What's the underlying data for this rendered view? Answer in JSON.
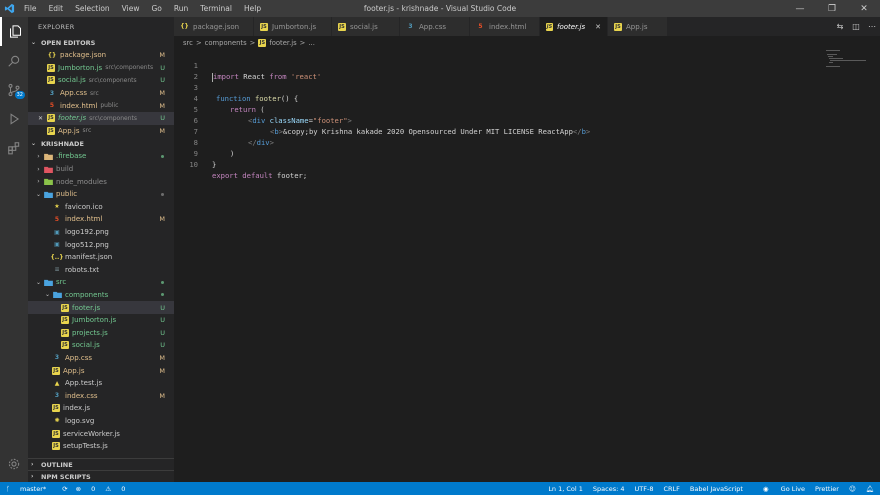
{
  "window": {
    "title": "footer.js - krishnade - Visual Studio Code",
    "menu": [
      "File",
      "Edit",
      "Selection",
      "View",
      "Go",
      "Run",
      "Terminal",
      "Help"
    ],
    "controls": [
      "—",
      "❐",
      "✕"
    ]
  },
  "activity": {
    "scm_badge": "32"
  },
  "sidebar": {
    "title": "EXPLORER",
    "open_editors_label": "OPEN EDITORS",
    "open_editors": [
      {
        "name": "package.json",
        "desc": "",
        "status": "M",
        "icon": "json-icon"
      },
      {
        "name": "Jumborton.js",
        "desc": "src\\components",
        "status": "U",
        "icon": "js-icon"
      },
      {
        "name": "social.js",
        "desc": "src\\components",
        "status": "U",
        "icon": "js-icon"
      },
      {
        "name": "App.css",
        "desc": "src",
        "status": "M",
        "icon": "css-icon"
      },
      {
        "name": "index.html",
        "desc": "public",
        "status": "M",
        "icon": "html-icon"
      },
      {
        "name": "footer.js",
        "desc": "src\\components",
        "status": "U",
        "icon": "js-icon"
      },
      {
        "name": "App.js",
        "desc": "src",
        "status": "M",
        "icon": "js-icon"
      }
    ],
    "project_label": "KRISHNADE",
    "tree": [
      {
        "name": ".firebase",
        "indent": 0,
        "type": "folder",
        "chev": "›"
      },
      {
        "name": "build",
        "indent": 0,
        "type": "folder",
        "chev": "›"
      },
      {
        "name": "node_modules",
        "indent": 0,
        "type": "folder",
        "chev": "›"
      },
      {
        "name": "public",
        "indent": 0,
        "type": "folder",
        "chev": "⌄"
      },
      {
        "name": "favicon.ico",
        "indent": 1,
        "type": "file",
        "icon": "star-icon"
      },
      {
        "name": "index.html",
        "indent": 1,
        "type": "file",
        "icon": "html-icon",
        "status": "M"
      },
      {
        "name": "logo192.png",
        "indent": 1,
        "type": "file",
        "icon": "image-icon"
      },
      {
        "name": "logo512.png",
        "indent": 1,
        "type": "file",
        "icon": "image-icon"
      },
      {
        "name": "manifest.json",
        "indent": 1,
        "type": "file",
        "icon": "braces-icon"
      },
      {
        "name": "robots.txt",
        "indent": 1,
        "type": "file",
        "icon": "text-icon"
      },
      {
        "name": "src",
        "indent": 0,
        "type": "folder",
        "chev": "⌄"
      },
      {
        "name": "components",
        "indent": 1,
        "type": "folder",
        "chev": "⌄"
      },
      {
        "name": "footer.js",
        "indent": 2,
        "type": "file",
        "icon": "js-icon",
        "status": "U"
      },
      {
        "name": "Jumborton.js",
        "indent": 2,
        "type": "file",
        "icon": "js-icon",
        "status": "U"
      },
      {
        "name": "projects.js",
        "indent": 2,
        "type": "file",
        "icon": "js-icon",
        "status": "U"
      },
      {
        "name": "social.js",
        "indent": 2,
        "type": "file",
        "icon": "js-icon",
        "status": "U"
      },
      {
        "name": "App.css",
        "indent": 1,
        "type": "file",
        "icon": "css-icon",
        "status": "M"
      },
      {
        "name": "App.js",
        "indent": 1,
        "type": "file",
        "icon": "js-icon",
        "status": "M"
      },
      {
        "name": "App.test.js",
        "indent": 1,
        "type": "file",
        "icon": "test-icon"
      },
      {
        "name": "index.css",
        "indent": 1,
        "type": "file",
        "icon": "css-icon",
        "status": "M"
      },
      {
        "name": "index.js",
        "indent": 1,
        "type": "file",
        "icon": "js-icon"
      },
      {
        "name": "logo.svg",
        "indent": 1,
        "type": "file",
        "icon": "svg-icon"
      },
      {
        "name": "serviceWorker.js",
        "indent": 1,
        "type": "file",
        "icon": "js-icon"
      },
      {
        "name": "setupTests.js",
        "indent": 1,
        "type": "file",
        "icon": "js-icon"
      }
    ],
    "outline_label": "OUTLINE",
    "npm_label": "NPM SCRIPTS"
  },
  "tabs": [
    {
      "label": "package.json",
      "icon": "json-icon"
    },
    {
      "label": "Jumborton.js",
      "icon": "js-icon"
    },
    {
      "label": "social.js",
      "icon": "js-icon"
    },
    {
      "label": "App.css",
      "icon": "css-icon"
    },
    {
      "label": "index.html",
      "icon": "html-icon"
    },
    {
      "label": "footer.js",
      "icon": "js-icon",
      "active": true
    },
    {
      "label": "App.js",
      "icon": "js-icon"
    }
  ],
  "breadcrumb": [
    "src",
    ">",
    "components",
    ">",
    "footer.js",
    ">",
    "..."
  ],
  "editor": {
    "line_numbers": [
      "1",
      "2",
      "3",
      "4",
      "5",
      "6",
      "7",
      "8",
      "9",
      "10"
    ],
    "code": {
      "l1_kw": "import",
      "l1_id": " React ",
      "l1_from": "from",
      "l1_str": " 'react'",
      "l4_kw": "function",
      "l4_fn": " footer",
      "l4_rest": "() {",
      "l5_kw": "return",
      "l5_rest": " (",
      "l6_tag": "div",
      "l6_attr": "className",
      "l6_eq": "=",
      "l6_str": "\"footer\"",
      "l7_tag": "b",
      "l7_text": "&copy;by Krishna kakade 2020 Opensourced Under MIT LICENSE ReactApp",
      "l8_tag": "div",
      "l9": ")",
      "l10": "}",
      "l11_kw": "export",
      "l11_kw2": " default",
      "l11_rest": " footer;"
    }
  },
  "status": {
    "branch": "master*",
    "sync": "⟳",
    "errors": "0",
    "warnings": "0",
    "position": "Ln 1, Col 1",
    "spaces": "Spaces: 4",
    "encoding": "UTF-8",
    "eol": "CRLF",
    "language": "Babel JavaScript",
    "golive": "Go Live",
    "prettier": "Prettier"
  },
  "colors": {
    "accent": "#007acc",
    "modified": "#e2c08d",
    "untracked": "#73c991"
  }
}
